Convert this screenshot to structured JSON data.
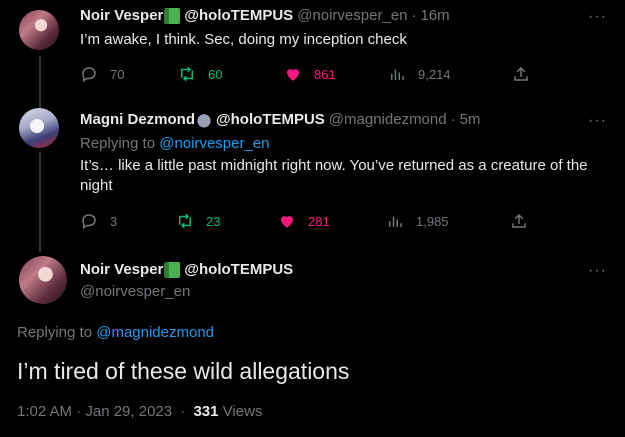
{
  "tweets": [
    {
      "name": "Noir Vesper",
      "tag": "@holoTEMPUS",
      "handle": "@noirvesper_en",
      "time": "16m",
      "text": "I’m awake, I think. Sec, doing my inception check",
      "replies": "70",
      "retweets": "60",
      "likes": "861",
      "views": "9,214"
    },
    {
      "name": "Magni Dezmond",
      "tag": "@holoTEMPUS",
      "handle": "@magnidezmond",
      "time": "5m",
      "replying_label": "Replying to",
      "replying_handle": "@noirvesper_en",
      "text": "It’s… like a little past midnight right now. You’ve returned as a creature of the night",
      "replies": "3",
      "retweets": "23",
      "likes": "281",
      "views": "1,985"
    }
  ],
  "focused": {
    "name": "Noir Vesper",
    "tag": "@holoTEMPUS",
    "handle": "@noirvesper_en",
    "replying_label": "Replying to",
    "replying_handle": "@magnidezmond",
    "text": "I’m tired of these wild allegations",
    "timestamp": "1:02 AM · Jan 29, 2023",
    "dot": "·",
    "views_count": "331",
    "views_label": "Views"
  },
  "separator": "·",
  "more_label": "···",
  "colors": {
    "accent": "#1d9bf0",
    "retweet": "#00ba7c",
    "like": "#f91880",
    "muted": "#71767b",
    "background": "#000000"
  }
}
